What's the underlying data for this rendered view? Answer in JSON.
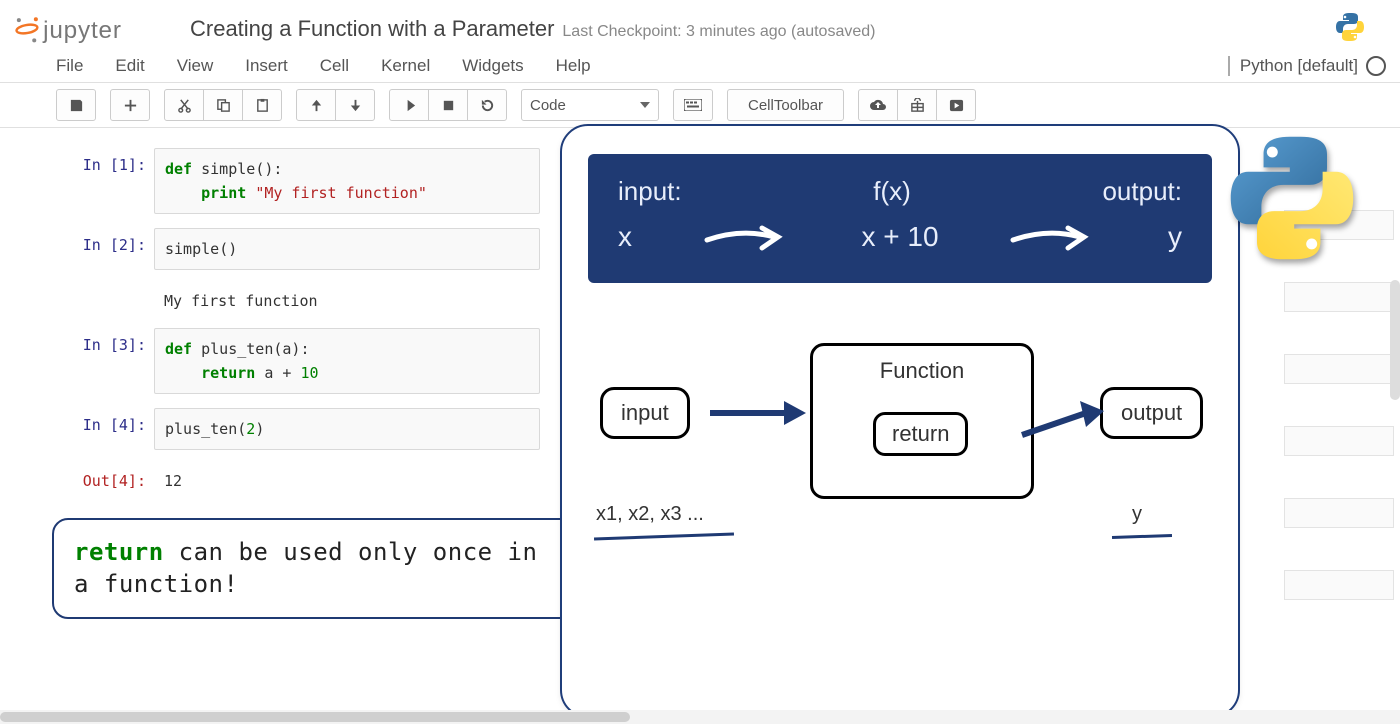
{
  "header": {
    "logo_text": "jupyter",
    "title": "Creating a Function with a Parameter",
    "checkpoint": "Last Checkpoint: 3 minutes ago (autosaved)"
  },
  "menubar": [
    "File",
    "Edit",
    "View",
    "Insert",
    "Cell",
    "Kernel",
    "Widgets",
    "Help"
  ],
  "kernel": {
    "name": "Python [default]"
  },
  "toolbar": {
    "celltype_value": "Code",
    "celltoolbar_label": "CellToolbar",
    "icons": [
      "save",
      "add",
      "cut",
      "copy",
      "paste",
      "up",
      "down",
      "run",
      "stop",
      "restart",
      "keyboard",
      "cloud",
      "gift",
      "play"
    ]
  },
  "cells": [
    {
      "prompt": "In [1]:",
      "type": "in",
      "code_html": "<span class='kw'>def</span> <span class='fn'>simple</span>():\n    <span class='kw'>print</span> <span class='str'>\"My first function\"</span>"
    },
    {
      "prompt": "In [2]:",
      "type": "in",
      "code_html": "<span class='fn'>simple</span>()"
    },
    {
      "prompt": "",
      "type": "stdout",
      "text": "My first function"
    },
    {
      "prompt": "In [3]:",
      "type": "in",
      "code_html": "<span class='kw'>def</span> <span class='fn'>plus_ten</span>(a):\n    <span class='kw'>return</span> a <span class='pn'>+</span> <span class='num'>10</span>"
    },
    {
      "prompt": "In [4]:",
      "type": "in",
      "code_html": "<span class='fn'>plus_ten</span>(<span class='num'>2</span>)"
    },
    {
      "prompt": "Out[4]:",
      "type": "out",
      "text": "12"
    }
  ],
  "callout": {
    "keyword": "return",
    "text_after": " can be used only once in a function!"
  },
  "diagram_top": {
    "input_label": "input:",
    "fx_label": "f(x)",
    "output_label": "output:",
    "x": "x",
    "middle": "x + 10",
    "y": "y"
  },
  "diagram_bottom": {
    "input_box": "input",
    "function_box": "Function",
    "return_box": "return",
    "output_box": "output",
    "xs_label": "x1, x2, x3 ...",
    "y_label": "y"
  }
}
